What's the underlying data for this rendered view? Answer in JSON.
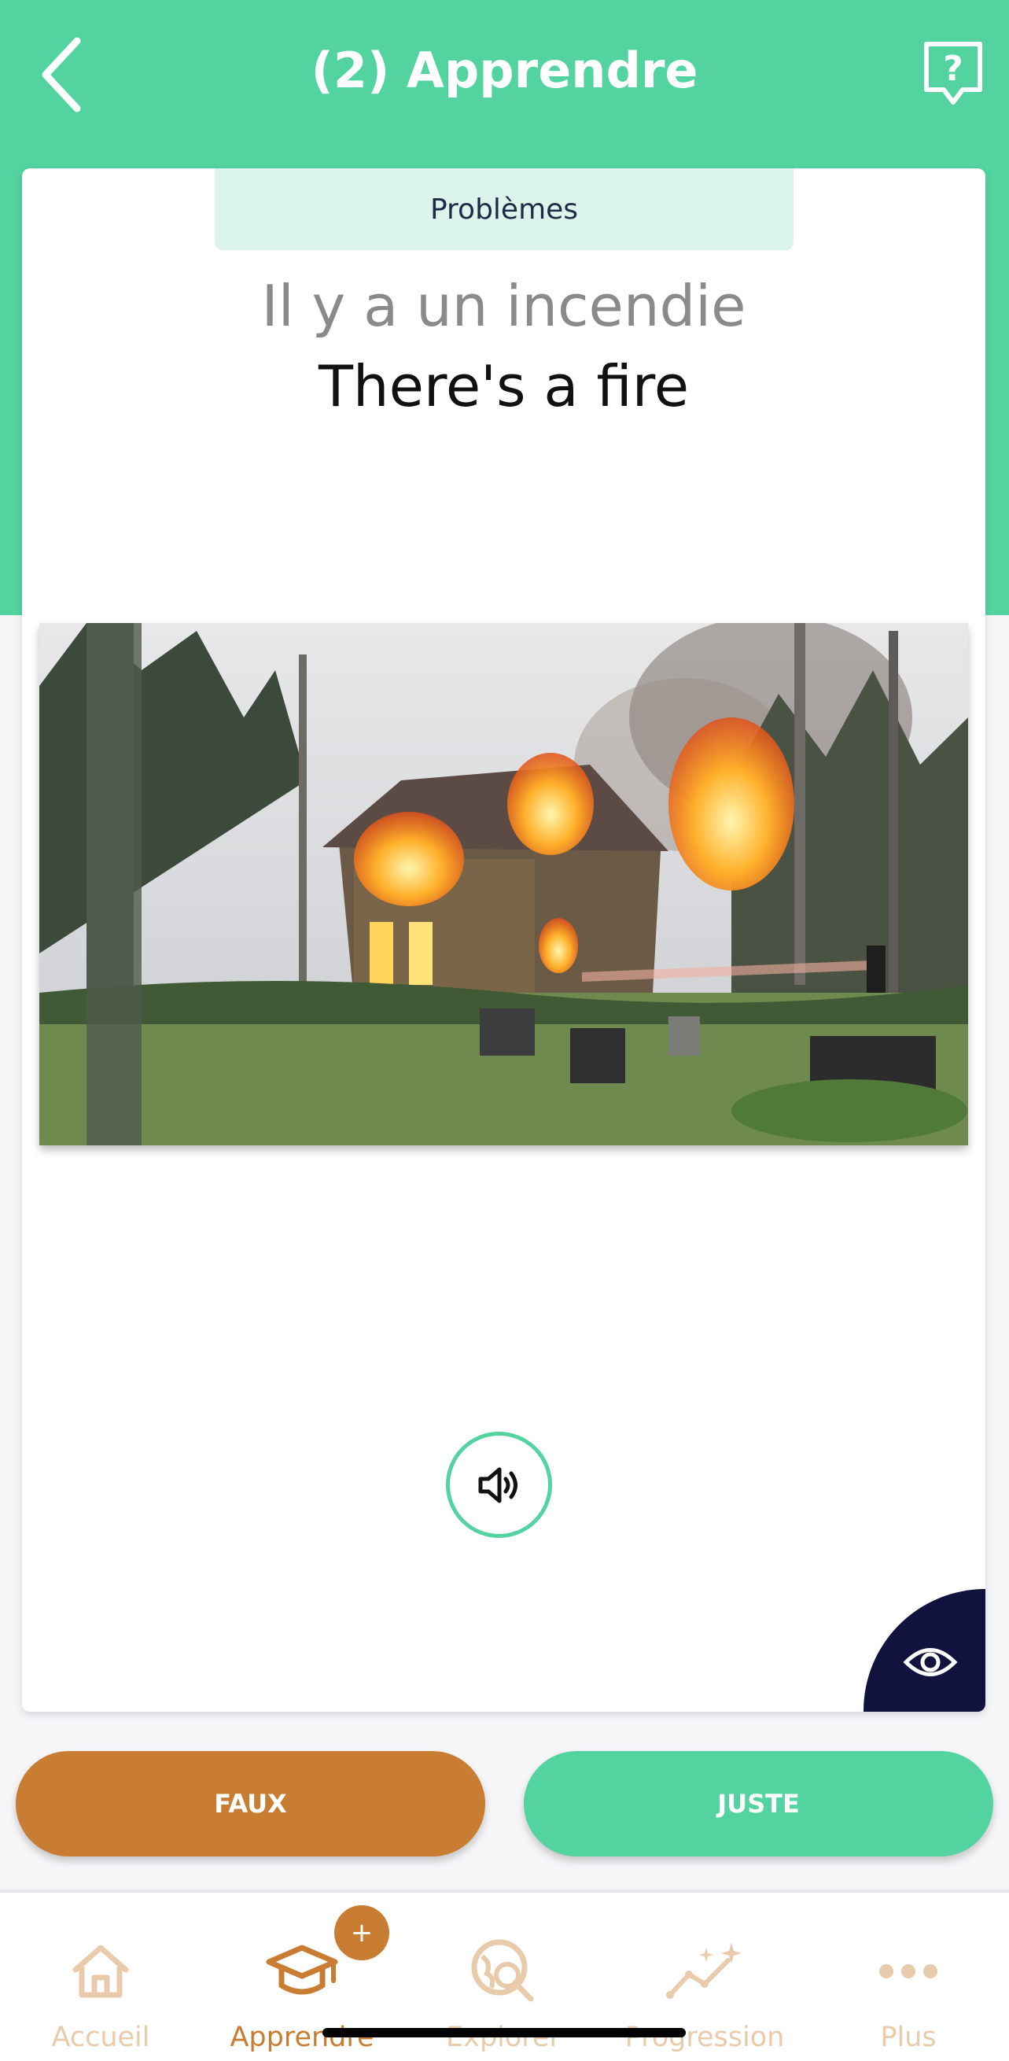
{
  "header": {
    "title": "(2) Apprendre",
    "back_icon": "chevron-left-icon",
    "help_icon": "question-bubble-icon"
  },
  "card": {
    "category": "Problèmes",
    "term_french": "Il y a un incendie",
    "term_english": "There's a fire",
    "image_subject": "house-on-fire-photo",
    "sound_icon": "speaker-icon",
    "reveal_icon": "eye-icon"
  },
  "answers": {
    "wrong_label": "FAUX",
    "right_label": "JUSTE"
  },
  "tabbar": {
    "badge": "+",
    "items": [
      {
        "label": "Accueil",
        "icon": "home-icon",
        "active": false
      },
      {
        "label": "Apprendre",
        "icon": "graduation-cap-icon",
        "active": true
      },
      {
        "label": "Explorer",
        "icon": "globe-search-icon",
        "active": false
      },
      {
        "label": "Progression",
        "icon": "sparkle-chart-icon",
        "active": false
      },
      {
        "label": "Plus",
        "icon": "more-dots-icon",
        "active": false
      }
    ]
  },
  "colors": {
    "accent_green": "#52d3a0",
    "accent_orange": "#c97d32",
    "navy": "#12123f",
    "tab_inactive": "#e8cbab"
  }
}
